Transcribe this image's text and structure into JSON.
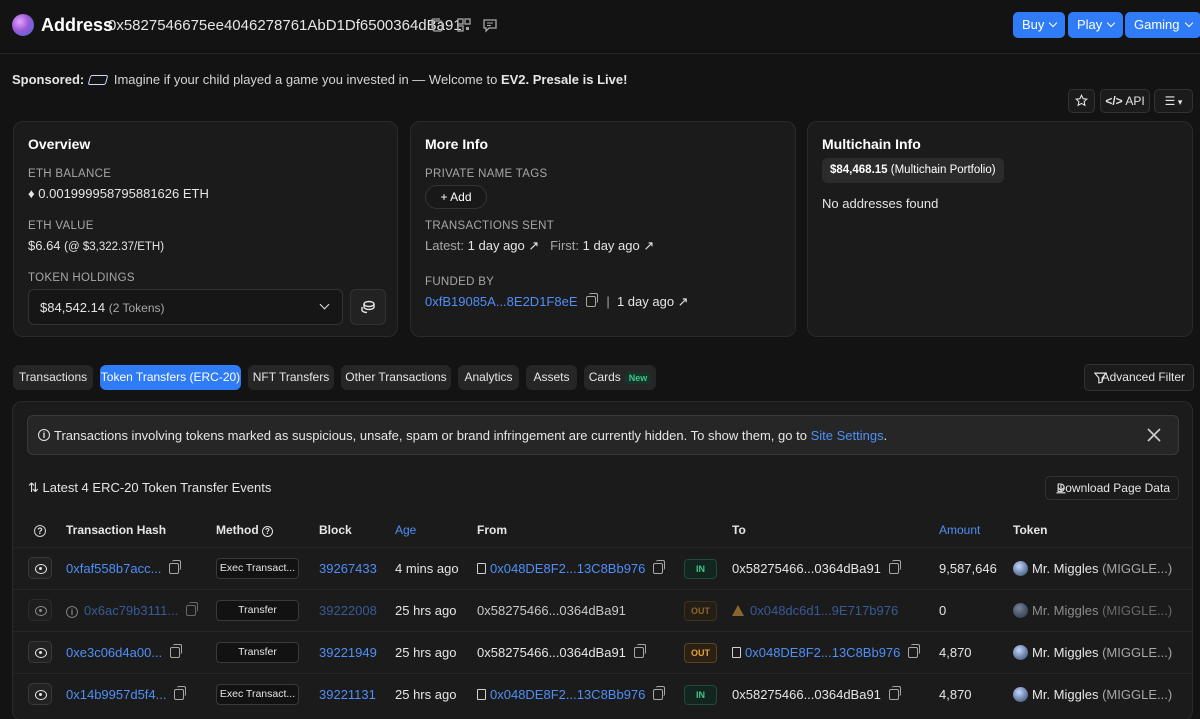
{
  "header": {
    "title": "Address",
    "address": "0x5827546675ee4046278761AbD1Df6500364dBa91",
    "buttons": {
      "buy": "Buy",
      "play": "Play",
      "gaming": "Gaming"
    }
  },
  "sponsored": {
    "label": "Sponsored:",
    "text": "Imagine if your child played a game you invested in — Welcome to",
    "brand": "EV2.",
    "cta": "Presale is Live!"
  },
  "actions": {
    "api": "API"
  },
  "overview": {
    "title": "Overview",
    "eth_balance_label": "ETH BALANCE",
    "eth_balance": "0.001999958795881626 ETH",
    "eth_value_label": "ETH VALUE",
    "eth_value": "$6.64",
    "eth_rate": "(@ $3,322.37/ETH)",
    "token_holdings_label": "TOKEN HOLDINGS",
    "token_holdings_value": "$84,542.14",
    "token_holdings_count": "(2 Tokens)"
  },
  "more_info": {
    "title": "More Info",
    "private_tags_label": "PRIVATE NAME TAGS",
    "add_label": "+ Add",
    "tx_sent_label": "TRANSACTIONS SENT",
    "latest_prefix": "Latest:",
    "latest_value": "1 day ago ↗",
    "first_prefix": "First:",
    "first_value": "1 day ago ↗",
    "funded_by_label": "FUNDED BY",
    "funded_by_addr": "0xfB19085A...8E2D1F8eE",
    "funded_by_sep": "|",
    "funded_by_time": "1 day ago ↗"
  },
  "multichain": {
    "title": "Multichain Info",
    "portfolio_value": "$84,468.15",
    "portfolio_label": "(Multichain Portfolio)",
    "empty": "No addresses found"
  },
  "tabs": [
    {
      "label": "Transactions",
      "active": false
    },
    {
      "label": "Token Transfers (ERC-20)",
      "active": true
    },
    {
      "label": "NFT Transfers",
      "active": false
    },
    {
      "label": "Other Transactions",
      "active": false
    },
    {
      "label": "Analytics",
      "active": false
    },
    {
      "label": "Assets",
      "active": false
    },
    {
      "label": "Cards",
      "active": false,
      "badge": "New"
    }
  ],
  "advanced_filter": "Advanced Filter",
  "alert": {
    "text": "Transactions involving tokens marked as suspicious, unsafe, spam or brand infringement are currently hidden. To show them, go to",
    "link": "Site Settings",
    "end": "."
  },
  "events_title": "Latest 4 ERC-20 Token Transfer Events",
  "download": "Download Page Data",
  "table": {
    "headers": {
      "hash": "Transaction Hash",
      "method": "Method",
      "block": "Block",
      "age": "Age",
      "from": "From",
      "to": "To",
      "amount": "Amount",
      "token": "Token"
    },
    "rows": [
      {
        "hash": "0xfaf558b7acc...",
        "method": "Exec Transact...",
        "block": "39267433",
        "age": "4 mins ago",
        "from": "0x048DE8F2...13C8Bb976",
        "dir": "IN",
        "to": "0x58275466...0364dBa91",
        "amount": "9,587,646",
        "token": "Mr. Miggles",
        "token_symbol": "(MIGGLE...)"
      },
      {
        "hash": "0x6ac79b3111...",
        "method": "Transfer",
        "block": "39222008",
        "age": "25 hrs ago",
        "from": "0x58275466...0364dBa91",
        "dir": "OUT",
        "to": "0x048dc6d1...9E717b976",
        "amount": "0",
        "token": "Mr. Miggles",
        "token_symbol": "(MIGGLE...)"
      },
      {
        "hash": "0xe3c06d4a00...",
        "method": "Transfer",
        "block": "39221949",
        "age": "25 hrs ago",
        "from": "0x58275466...0364dBa91",
        "dir": "OUT",
        "to": "0x048DE8F2...13C8Bb976",
        "amount": "4,870",
        "token": "Mr. Miggles",
        "token_symbol": "(MIGGLE...)"
      },
      {
        "hash": "0x14b9957d5f4...",
        "method": "Exec Transact...",
        "block": "39221131",
        "age": "25 hrs ago",
        "from": "0x048DE8F2...13C8Bb976",
        "dir": "IN",
        "to": "0x58275466...0364dBa91",
        "amount": "4,870",
        "token": "Mr. Miggles",
        "token_symbol": "(MIGGLE...)"
      }
    ]
  }
}
